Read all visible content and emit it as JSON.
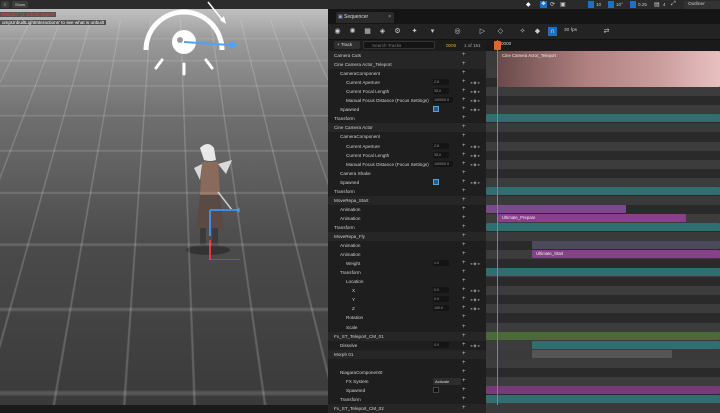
{
  "viewport": {
    "view_label": "Show",
    "warnings": [
      "RIBUILT (1 unbuilt object)",
      "umpUnbuiltLightInteractions' to see what is unbuilt"
    ]
  },
  "top_strip": {
    "values": [
      "10",
      "10°",
      "0.25",
      "4"
    ],
    "outliner_label": "Outliner"
  },
  "sequencer": {
    "tab_label": "Sequencer",
    "fps": "30 fps",
    "add_track_label": "+ Track",
    "search_placeholder": "Search Tracks",
    "current_frame": "0000",
    "frame_count": "1 of 151",
    "ruler_frame": "0000",
    "tracks": [
      {
        "label": "Camera Cuts",
        "indent": 0,
        "hdr": true
      },
      {
        "label": "Cine Camera Actor_Teleport",
        "indent": 0,
        "hdr": true
      },
      {
        "label": "CameraComponent",
        "indent": 1
      },
      {
        "label": "Current Aperture",
        "indent": 2,
        "value": "2.8"
      },
      {
        "label": "Current Focal Length",
        "indent": 2,
        "value": "35.0"
      },
      {
        "label": "Manual Focus Distance (Focus Settings)",
        "indent": 2,
        "value": "100000.0"
      },
      {
        "label": "Spawned",
        "indent": 1,
        "check": true
      },
      {
        "label": "Transform",
        "indent": 0
      },
      {
        "label": "Cine Camera Actor",
        "indent": 0,
        "hdr": true
      },
      {
        "label": "CameraComponent",
        "indent": 1
      },
      {
        "label": "Current Aperture",
        "indent": 2,
        "value": "2.8"
      },
      {
        "label": "Current Focal Length",
        "indent": 2,
        "value": "35.0"
      },
      {
        "label": "Manual Focus Distance (Focus Settings)",
        "indent": 2,
        "value": "100000.0"
      },
      {
        "label": "Camera Shake",
        "indent": 1
      },
      {
        "label": "Spawned",
        "indent": 1,
        "check": true
      },
      {
        "label": "Transform",
        "indent": 0
      },
      {
        "label": "MoveRepa_Start",
        "indent": 0,
        "hdr": true
      },
      {
        "label": "Animation",
        "indent": 1
      },
      {
        "label": "Animation",
        "indent": 1
      },
      {
        "label": "Transform",
        "indent": 0
      },
      {
        "label": "MoveRepa_Fly",
        "indent": 0,
        "hdr": true
      },
      {
        "label": "Animation",
        "indent": 1
      },
      {
        "label": "Animation",
        "indent": 1
      },
      {
        "label": "Weight",
        "indent": 2,
        "value": "1.0"
      },
      {
        "label": "Transform",
        "indent": 1
      },
      {
        "label": "Location",
        "indent": 2
      },
      {
        "label": "X",
        "indent": 3,
        "value": "0.0"
      },
      {
        "label": "Y",
        "indent": 3,
        "value": "0.0"
      },
      {
        "label": "Z",
        "indent": 3,
        "value": "100.0"
      },
      {
        "label": "Rotation",
        "indent": 2
      },
      {
        "label": "Scale",
        "indent": 2
      },
      {
        "label": "Fx_ST_Teleport_CM_01",
        "indent": 0,
        "hdr": true
      },
      {
        "label": "Dissolve",
        "indent": 1,
        "value": "0.0"
      },
      {
        "label": "Morph 01",
        "indent": 0,
        "hdr": true
      },
      {
        "label": "",
        "indent": 1
      },
      {
        "label": "NiagaraComponent0",
        "indent": 1
      },
      {
        "label": "FX System",
        "indent": 2,
        "dropdown": "Activate"
      },
      {
        "label": "Spawned",
        "indent": 2,
        "check_dark": true
      },
      {
        "label": "Transform",
        "indent": 1
      },
      {
        "label": "Fx_ST_Teleport_CM_02",
        "indent": 0,
        "hdr": true
      }
    ],
    "bar_labels": {
      "camera_cut": "Cine Camera Actor_Teleport",
      "ultimate_prepare": "Ultimate_Prepare",
      "ultimate_start": "Ultimate_Start"
    }
  }
}
